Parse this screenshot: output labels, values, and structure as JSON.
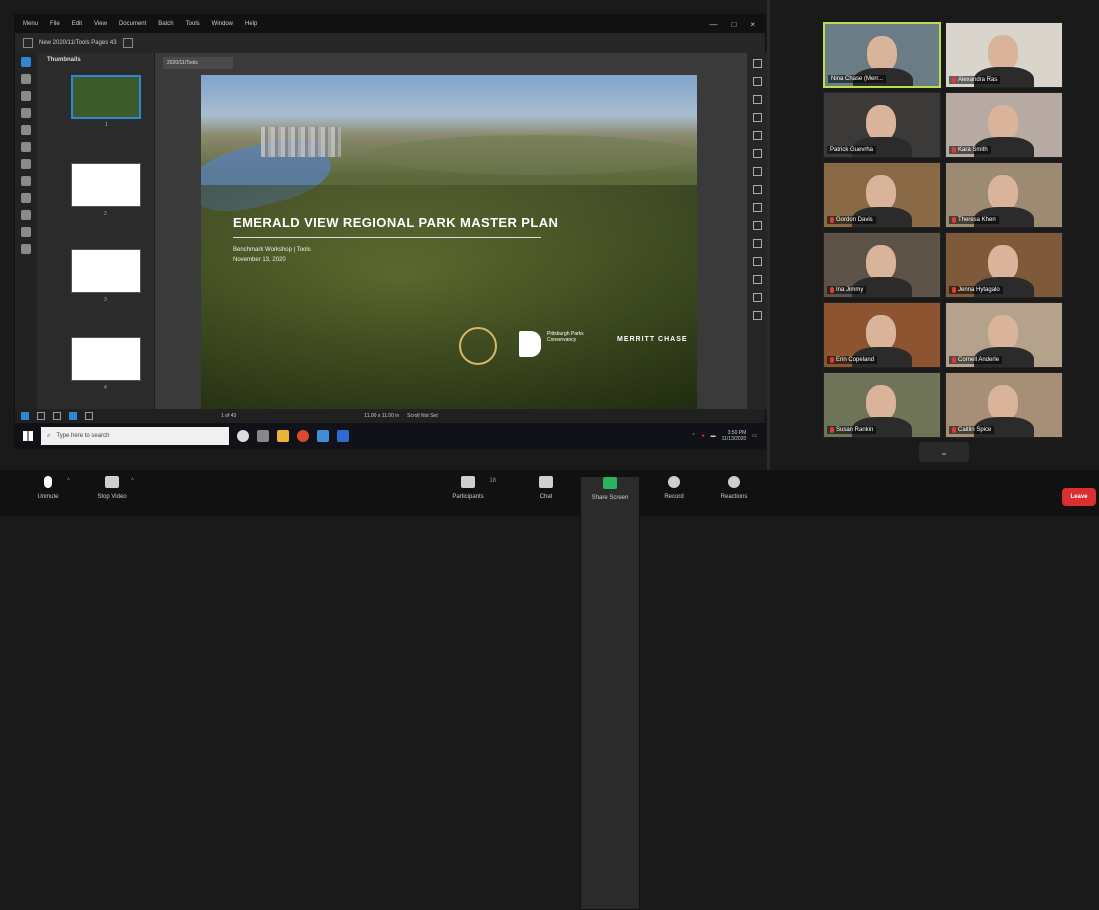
{
  "app": {
    "menu": [
      "Menu",
      "File",
      "Edit",
      "View",
      "Document",
      "Batch",
      "Tools",
      "Window",
      "Help"
    ],
    "window_buttons": [
      "—",
      "□",
      "×"
    ],
    "file_label": "New 2020/11/Tools  Pages 43",
    "panel_title": "Thumbnails",
    "doc_tab": "2020/11/Tools",
    "search_placeholder": "Type here to search",
    "page_indicator": "1 of 43",
    "size_readout": "11.00 x 11.00 in",
    "scroll_label": "Scroll Not Set",
    "tray_time": "3:50 PM",
    "tray_date": "11/13/2020",
    "thumb_pages": [
      "1",
      "2",
      "3",
      "4"
    ]
  },
  "slide": {
    "title": "EMERALD VIEW REGIONAL PARK MASTER PLAN",
    "subtitle": "Benchmark Workshop | Tools",
    "date": "November 13, 2020",
    "partner_text": "Pittsburgh Parks Conservancy",
    "merritt_chase": "MERRITT CHASE"
  },
  "participants": [
    {
      "name": "Nina Chase (Merr...",
      "active": true,
      "muted": false,
      "bg": "#6a7c86"
    },
    {
      "name": "Alexandra Ras",
      "active": false,
      "muted": true,
      "bg": "#d9d4cc"
    },
    {
      "name": "Patrick Guevrha",
      "active": false,
      "muted": false,
      "bg": "#3c3a38"
    },
    {
      "name": "Kara Smith",
      "active": false,
      "muted": true,
      "bg": "#b7aaa2"
    },
    {
      "name": "Gordon Davis",
      "active": false,
      "muted": true,
      "bg": "#8a6a46"
    },
    {
      "name": "Theresa Khen",
      "active": false,
      "muted": true,
      "bg": "#9c8b72"
    },
    {
      "name": "Ina Jimmy",
      "active": false,
      "muted": true,
      "bg": "#5d5248"
    },
    {
      "name": "Jenna Hytagalo",
      "active": false,
      "muted": true,
      "bg": "#7e5a3a"
    },
    {
      "name": "Erin Copeland",
      "active": false,
      "muted": true,
      "bg": "#8c5430"
    },
    {
      "name": "Cornell Anderle",
      "active": false,
      "muted": true,
      "bg": "#b5a28c"
    },
    {
      "name": "Susan Rankin",
      "active": false,
      "muted": true,
      "bg": "#6f7358"
    },
    {
      "name": "Caitlin Spice",
      "active": false,
      "muted": true,
      "bg": "#a68f76"
    }
  ],
  "controls": {
    "unmute": "Unmute",
    "stop_video": "Stop Video",
    "participants": "Participants",
    "participant_count": "18",
    "chat": "Chat",
    "share_screen": "Share Screen",
    "record": "Record",
    "reactions": "Reactions",
    "leave": "Leave"
  }
}
